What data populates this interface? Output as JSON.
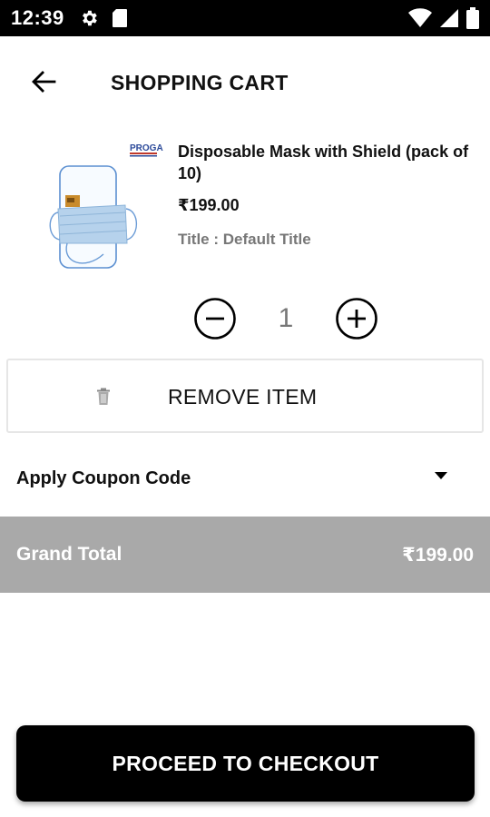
{
  "status_bar": {
    "time": "12:39",
    "icons": [
      "gear-icon",
      "sd-card-icon",
      "wifi-icon",
      "signal-icon",
      "battery-icon"
    ]
  },
  "header": {
    "title": "SHOPPING CART",
    "back_icon": "arrow-left-icon"
  },
  "cart": {
    "item": {
      "brand_logo_text": "PROGA",
      "name": "Disposable Mask with Shield (pack of 10)",
      "price": "₹199.00",
      "variant": "Title : Default Title",
      "quantity": "1"
    },
    "remove_label": "REMOVE ITEM"
  },
  "coupon": {
    "label": "Apply Coupon Code"
  },
  "totals": {
    "label": "Grand Total",
    "value": "₹199.00"
  },
  "checkout": {
    "label": "PROCEED TO CHECKOUT"
  },
  "colors": {
    "status_bar": "#000000",
    "grand_total_bg": "#a9a9a9",
    "checkout_bg": "#000000",
    "muted_text": "#777777"
  }
}
